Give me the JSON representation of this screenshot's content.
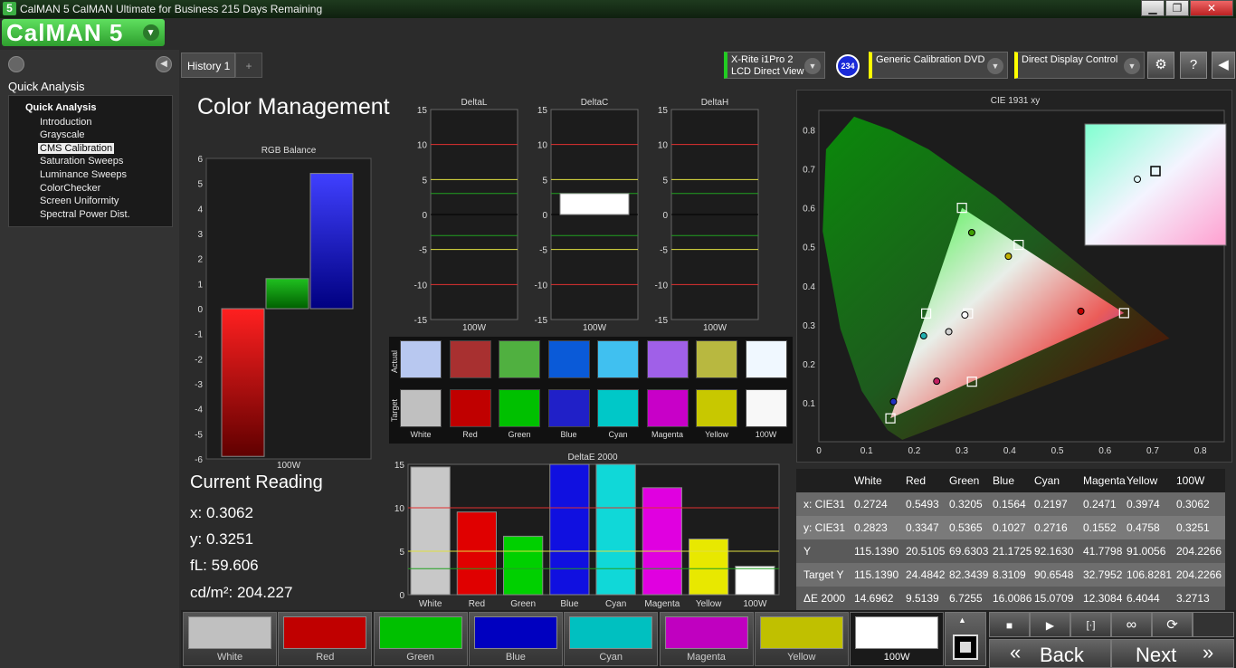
{
  "window": {
    "icon_glyph": "5",
    "title": "CalMAN 5 CalMAN Ultimate for Business 215 Days Remaining",
    "min": "▁",
    "max": "❐",
    "close": "✕"
  },
  "logo": {
    "text": "CalMAN 5",
    "dropdown": "▾"
  },
  "sidebar": {
    "back_glyph": "◀",
    "heading": "Quick Analysis",
    "tree_root": "Quick Analysis",
    "items": [
      "Introduction",
      "Grayscale",
      "CMS Calibration",
      "Saturation Sweeps",
      "Luminance Sweeps",
      "ColorChecker",
      "Screen Uniformity",
      "Spectral Power Dist."
    ],
    "selected": "CMS Calibration"
  },
  "tabs": {
    "history": "History 1",
    "add": "+"
  },
  "devices": [
    {
      "line1": "X-Rite i1Pro 2",
      "line2": "LCD Direct View",
      "accent": "#22cc22"
    },
    {
      "line1": "Generic Calibration DVD",
      "line2": "",
      "accent": "#ffff00"
    },
    {
      "line1": "Direct Display Control",
      "line2": "",
      "accent": "#ffff00"
    }
  ],
  "badge": "234",
  "toolbar": {
    "settings": "⚙",
    "help": "?",
    "collapse": "◀"
  },
  "page_title": "Color Management",
  "rgb_balance": {
    "title": "RGB Balance",
    "xlabel": "100W",
    "red": -5.9,
    "green": 1.2,
    "blue": 5.4,
    "ylim": [
      -6,
      6
    ],
    "ticks": [
      "6",
      "5",
      "4",
      "3",
      "2",
      "1",
      "0",
      "-1",
      "-2",
      "-3",
      "-4",
      "-5",
      "-6"
    ]
  },
  "delta_charts": [
    {
      "title": "DeltaL",
      "xlabel": "100W",
      "value": null
    },
    {
      "title": "DeltaC",
      "xlabel": "100W",
      "value": 3.0
    },
    {
      "title": "DeltaH",
      "xlabel": "100W",
      "value": null
    }
  ],
  "delta_ticks": [
    "15",
    "10",
    "5",
    "0",
    "-5",
    "-10",
    "-15"
  ],
  "swatches": {
    "actual_label": "Actual",
    "target_label": "Target",
    "names": [
      "White",
      "Red",
      "Green",
      "Blue",
      "Cyan",
      "Magenta",
      "Yellow",
      "100W"
    ],
    "actual": [
      "#b8c8f0",
      "#a83030",
      "#50b040",
      "#0a5ad8",
      "#40c0f0",
      "#a060e8",
      "#b8b840",
      "#f0f8ff"
    ],
    "target": [
      "#c0c0c0",
      "#c00000",
      "#00c000",
      "#2020c8",
      "#00c8c8",
      "#c800c8",
      "#c8c800",
      "#f8f8f8"
    ]
  },
  "deltae": {
    "title": "DeltaE 2000",
    "ticks": [
      "15",
      "10",
      "5",
      "0"
    ],
    "values": [
      14.6962,
      9.5139,
      6.7255,
      16.0086,
      15.0709,
      12.3084,
      6.4044,
      3.2713
    ],
    "colors": [
      "#c8c8c8",
      "#e00000",
      "#00d000",
      "#1010e0",
      "#10d8d8",
      "#e000e0",
      "#e8e800",
      "#ffffff"
    ]
  },
  "current_reading": {
    "title": "Current Reading",
    "x": "x: 0.3062",
    "y": "y: 0.3251",
    "fl": "fL: 59.606",
    "cdm": "cd/m²: 204.227"
  },
  "cie": {
    "title": "CIE 1931 xy",
    "xticks": [
      "0",
      "0.1",
      "0.2",
      "0.3",
      "0.4",
      "0.5",
      "0.6",
      "0.7",
      "0.8"
    ],
    "yticks": [
      "0.8",
      "0.7",
      "0.6",
      "0.5",
      "0.4",
      "0.3",
      "0.2",
      "0.1"
    ],
    "targets": [
      [
        0.64,
        0.33
      ],
      [
        0.3,
        0.6
      ],
      [
        0.15,
        0.06
      ],
      [
        0.225,
        0.329
      ],
      [
        0.321,
        0.154
      ],
      [
        0.419,
        0.505
      ],
      [
        0.3127,
        0.329
      ]
    ],
    "measured": [
      [
        0.5493,
        0.3347
      ],
      [
        0.3205,
        0.5365
      ],
      [
        0.1564,
        0.1027
      ],
      [
        0.2197,
        0.2716
      ],
      [
        0.2471,
        0.1552
      ],
      [
        0.3974,
        0.4758
      ],
      [
        0.2724,
        0.2823
      ],
      [
        0.3062,
        0.3251
      ]
    ],
    "measured_colors": [
      "#c00000",
      "#40a000",
      "#2030c0",
      "#20b0b0",
      "#c02060",
      "#c0b000",
      "#d0d0d0",
      "#ffffff"
    ]
  },
  "table": {
    "headers": [
      "",
      "White",
      "Red",
      "Green",
      "Blue",
      "Cyan",
      "Magenta",
      "Yellow",
      "100W"
    ],
    "rows": [
      [
        "x: CIE31",
        "0.2724",
        "0.5493",
        "0.3205",
        "0.1564",
        "0.2197",
        "0.2471",
        "0.3974",
        "0.3062"
      ],
      [
        "y: CIE31",
        "0.2823",
        "0.3347",
        "0.5365",
        "0.1027",
        "0.2716",
        "0.1552",
        "0.4758",
        "0.3251"
      ],
      [
        "Y",
        "115.1390",
        "20.5105",
        "69.6303",
        "21.1725",
        "92.1630",
        "41.7798",
        "91.0056",
        "204.2266"
      ],
      [
        "Target Y",
        "115.1390",
        "24.4842",
        "82.3439",
        "8.3109",
        "90.6548",
        "32.7952",
        "106.8281",
        "204.2266"
      ],
      [
        "ΔE 2000",
        "14.6962",
        "9.5139",
        "6.7255",
        "16.0086",
        "15.0709",
        "12.3084",
        "6.4044",
        "3.2713"
      ]
    ]
  },
  "patches": [
    {
      "label": "White",
      "color": "#c0c0c0"
    },
    {
      "label": "Red",
      "color": "#c00000"
    },
    {
      "label": "Green",
      "color": "#00c000"
    },
    {
      "label": "Blue",
      "color": "#0000c0"
    },
    {
      "label": "Cyan",
      "color": "#00c0c0"
    },
    {
      "label": "Magenta",
      "color": "#c000c0"
    },
    {
      "label": "Yellow",
      "color": "#c0c000"
    },
    {
      "label": "100W",
      "color": "#ffffff"
    }
  ],
  "controls": {
    "back": "Back",
    "next": "Next",
    "stop": "■",
    "play": "▶",
    "fit": "[·]",
    "loop": "∞",
    "refresh": "⟳",
    "up": "▲",
    "back_arrows": "«",
    "next_arrows": "»"
  }
}
